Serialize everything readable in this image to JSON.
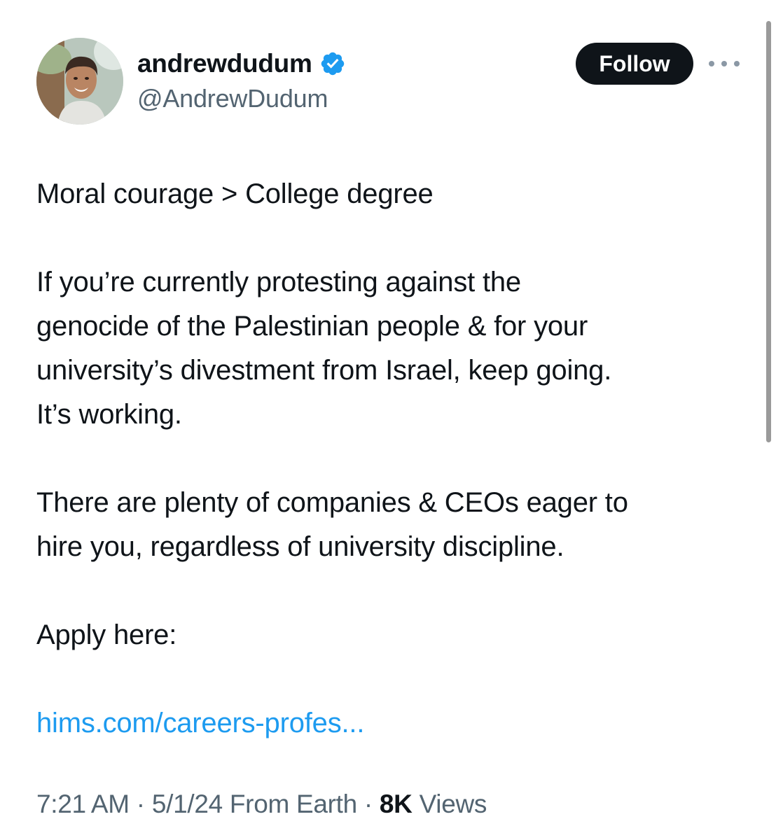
{
  "author": {
    "display_name": "andrewdudum",
    "handle": "@AndrewDudum",
    "verified": true
  },
  "actions": {
    "follow_label": "Follow",
    "more_icon": "more-horizontal-icon"
  },
  "tweet": {
    "line1": "Moral courage > College degree",
    "para2": [
      "If you’re currently protesting against the",
      "genocide of the Palestinian people & for your",
      "university’s divestment from Israel, keep going.",
      "It’s working."
    ],
    "para3": [
      "There are plenty of companies & CEOs eager to",
      "hire you, regardless of university discipline."
    ],
    "apply": "Apply here:",
    "link": "hims.com/careers-profes..."
  },
  "meta": {
    "time": "7:21 AM",
    "sep1": " · ",
    "date": "5/1/24",
    "source": " From Earth",
    "sep2": " · ",
    "views_count": "8K",
    "views_label": " Views"
  },
  "colors": {
    "link": "#1d9bf0",
    "verified_badge": "#1d9bf0",
    "follow_button": "#0f1419",
    "secondary_text": "#536471"
  }
}
